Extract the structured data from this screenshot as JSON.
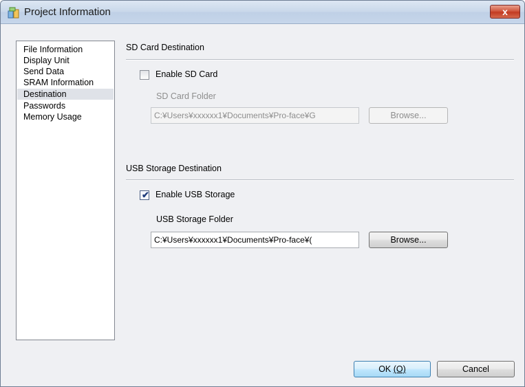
{
  "window": {
    "title": "Project Information",
    "close_label": "x"
  },
  "nav": {
    "items": [
      {
        "label": "File Information"
      },
      {
        "label": "Display Unit"
      },
      {
        "label": "Send Data"
      },
      {
        "label": "SRAM Information"
      },
      {
        "label": "Destination",
        "selected": true
      },
      {
        "label": "Passwords"
      },
      {
        "label": "Memory Usage"
      }
    ]
  },
  "sd_card": {
    "section_title": "SD Card Destination",
    "enable_label": "Enable SD Card",
    "enabled": false,
    "folder_label": "SD Card Folder",
    "folder_value": "C:¥Users¥xxxxxx1¥Documents¥Pro-face¥G",
    "browse_label": "Browse..."
  },
  "usb": {
    "section_title": "USB Storage Destination",
    "enable_label": "Enable USB Storage",
    "enabled": true,
    "folder_label": "USB Storage Folder",
    "folder_value": "C:¥Users¥xxxxxx1¥Documents¥Pro-face¥(",
    "browse_label": "Browse..."
  },
  "footer": {
    "ok_text": "OK ",
    "ok_accel": "(O)",
    "cancel_label": "Cancel"
  },
  "colors": {
    "window_bg": "#eff0f3",
    "selection": "#dfe2e8",
    "close_button": "#c33a22",
    "default_button": "#bee6fd"
  }
}
